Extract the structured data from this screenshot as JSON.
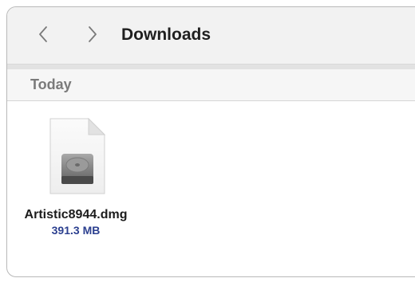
{
  "window": {
    "title": "Downloads"
  },
  "navigation": {
    "back_icon": "chevron-left-icon",
    "forward_icon": "chevron-right-icon"
  },
  "section": {
    "title": "Today"
  },
  "files": [
    {
      "name": "Artistic8944.dmg",
      "size": "391.3 MB",
      "icon": "disk-image-file-icon"
    }
  ],
  "colors": {
    "toolbar_background": "#f2f2f2",
    "section_title": "#7a7a7a",
    "file_size_text": "#2b3f8f",
    "window_border": "#b8b8b8"
  }
}
